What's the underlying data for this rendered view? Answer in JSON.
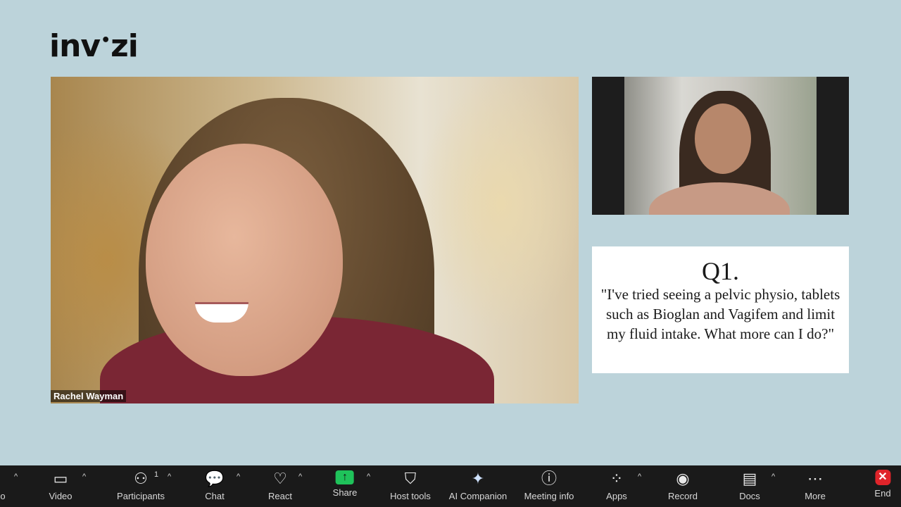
{
  "brand": {
    "logo_text_a": "inv",
    "logo_dot": "•",
    "logo_text_b": "zi"
  },
  "main_video": {
    "participant_name": "Rachel Wayman"
  },
  "question": {
    "number": "Q1.",
    "text": "\"I've tried seeing a pelvic physio, tablets such as Bioglan and Vagifem and limit my fluid intake. What more can I do?\""
  },
  "toolbar": {
    "left_partial_label": "o",
    "items": [
      {
        "label": "Video",
        "icon": "video-camera-icon",
        "glyph": "▭"
      },
      {
        "label": "Participants",
        "icon": "participants-icon",
        "glyph": "⚇",
        "count": "1"
      },
      {
        "label": "Chat",
        "icon": "chat-icon",
        "glyph": "💬"
      },
      {
        "label": "React",
        "icon": "heart-icon",
        "glyph": "♡"
      },
      {
        "label": "Share",
        "icon": "share-icon",
        "glyph": "↑"
      },
      {
        "label": "Host tools",
        "icon": "shield-icon",
        "glyph": "⛉"
      },
      {
        "label": "AI Companion",
        "icon": "sparkle-icon",
        "glyph": "✦"
      },
      {
        "label": "Meeting info",
        "icon": "info-icon",
        "glyph": "ⓘ"
      },
      {
        "label": "Apps",
        "icon": "apps-icon",
        "glyph": "⁘"
      },
      {
        "label": "Record",
        "icon": "record-icon",
        "glyph": "◉"
      },
      {
        "label": "Docs",
        "icon": "document-icon",
        "glyph": "▤"
      },
      {
        "label": "More",
        "icon": "more-icon",
        "glyph": "⋯"
      },
      {
        "label": "End",
        "icon": "end-icon",
        "glyph": "✕"
      }
    ],
    "caret_glyph": "^"
  },
  "colors": {
    "background": "#bcd3da",
    "toolbar": "#1a1a1a",
    "share_green": "#1fc25a",
    "end_red": "#e0242a"
  }
}
